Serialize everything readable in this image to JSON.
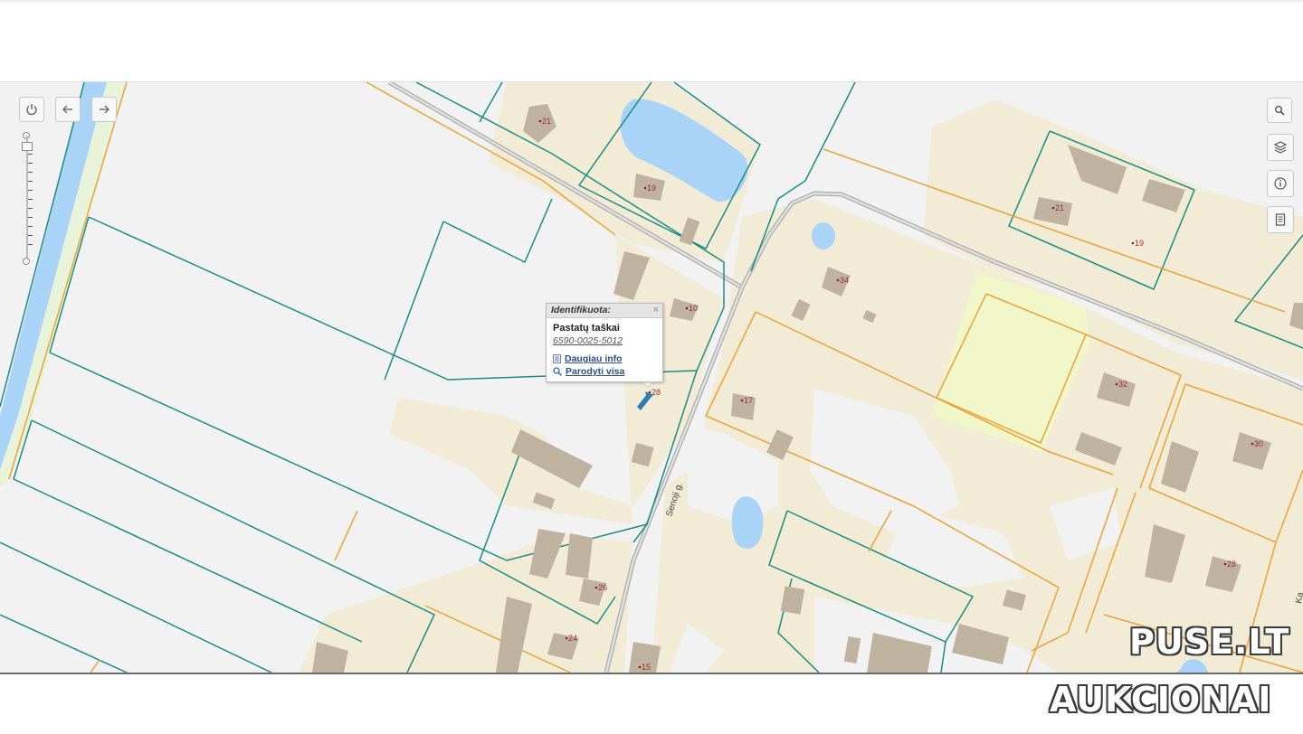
{
  "map": {
    "house_numbers": [
      {
        "label": "21"
      },
      {
        "label": "19"
      },
      {
        "label": "34"
      },
      {
        "label": "21"
      },
      {
        "label": "19"
      },
      {
        "label": "10"
      },
      {
        "label": "17"
      },
      {
        "label": "32"
      },
      {
        "label": "30"
      },
      {
        "label": "28"
      },
      {
        "label": "26"
      },
      {
        "label": "24"
      },
      {
        "label": "15"
      },
      {
        "label": "28"
      }
    ],
    "street_label": "Senoji g.",
    "colors": {
      "background": "#f2f2f2",
      "land": "#f2ebd6",
      "building": "#bfb3a0",
      "water": "#a9d3f7",
      "teal_parcel": "#1c8c83",
      "orange_parcel": "#e8a33a",
      "road": "#a8a8a8",
      "highlight": "#f2f7c9"
    }
  },
  "controls": {
    "home_icon": "power-icon",
    "back_icon": "arrow-left-icon",
    "forward_icon": "arrow-right-icon",
    "right_tools": [
      "search-icon",
      "layers-icon",
      "info-icon",
      "document-icon"
    ]
  },
  "popup": {
    "header": "Identifikuota:",
    "close": "×",
    "title": "Pastatų taškai",
    "id": "6590-0025-5012",
    "link_more": "Daugiau info",
    "link_show_all": "Parodyti visa"
  },
  "watermark": {
    "line1": "PUSE.LT",
    "line2": "AUKCIONAI"
  }
}
